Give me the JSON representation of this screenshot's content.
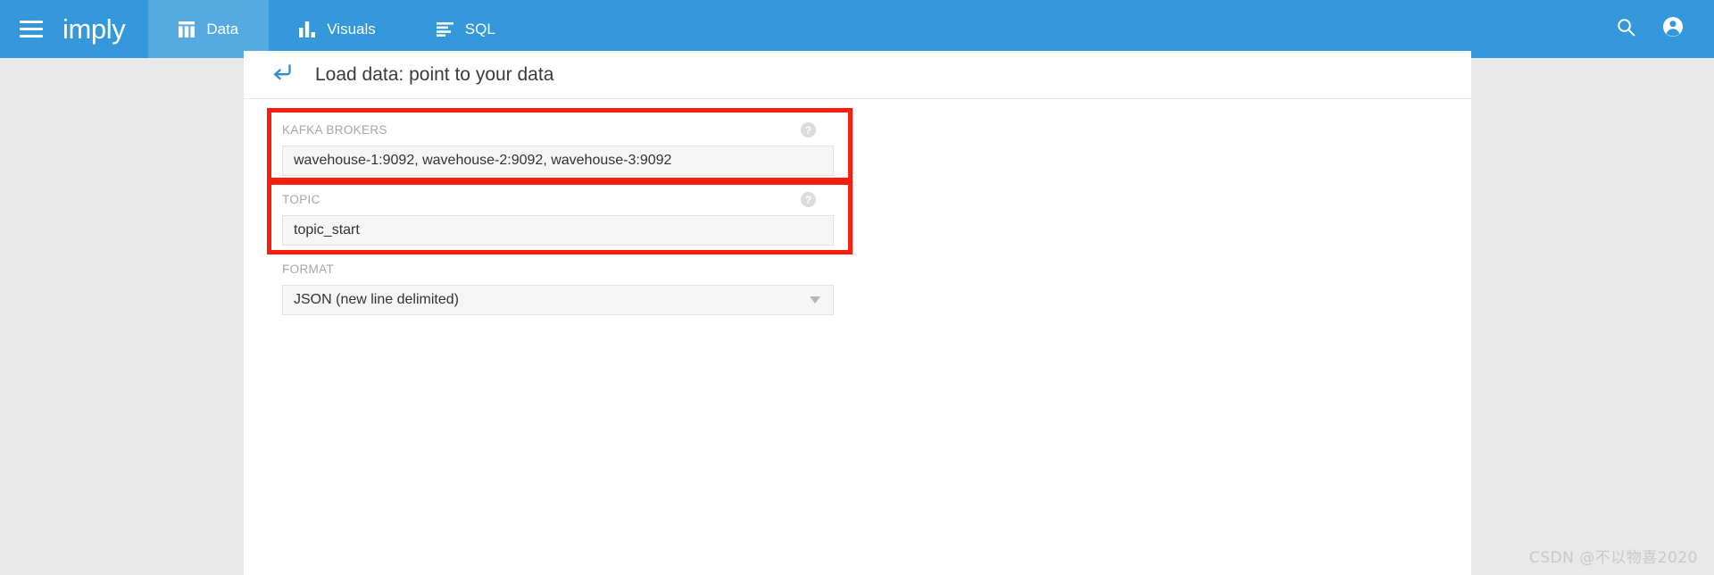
{
  "topbar": {
    "menu_icon": "hamburger-menu-icon",
    "brand": "imply",
    "search_icon": "search-icon",
    "account_icon": "account-circle-icon",
    "tabs": [
      {
        "label": "Data",
        "icon": "table-chart-icon",
        "active": true
      },
      {
        "label": "Visuals",
        "icon": "bar-chart-icon",
        "active": false
      },
      {
        "label": "SQL",
        "icon": "text-lines-icon",
        "active": false
      }
    ],
    "background_color": "#3498db",
    "active_tab_color": "#55aae2"
  },
  "panel": {
    "back_icon": "back-arrow-icon",
    "title": "Load data: point to your data",
    "fields": [
      {
        "id": "kafka-brokers",
        "label": "KAFKA BROKERS",
        "value": "wavehouse-1:9092, wavehouse-2:9092, wavehouse-3:9092",
        "placeholder": "",
        "help_icon": "help-circle-icon",
        "has_help": true,
        "type": "text",
        "highlighted": true
      },
      {
        "id": "topic",
        "label": "TOPIC",
        "value": "topic_start",
        "placeholder": "",
        "help_icon": "help-circle-icon",
        "has_help": true,
        "type": "text",
        "highlighted": true
      },
      {
        "id": "format",
        "label": "FORMAT",
        "value": "JSON (new line delimited)",
        "placeholder": "",
        "help_icon": "",
        "has_help": false,
        "type": "select",
        "highlighted": false
      }
    ],
    "highlight_color": "#fb1d0d"
  },
  "watermark": {
    "text": "CSDN @不以物喜2020"
  }
}
